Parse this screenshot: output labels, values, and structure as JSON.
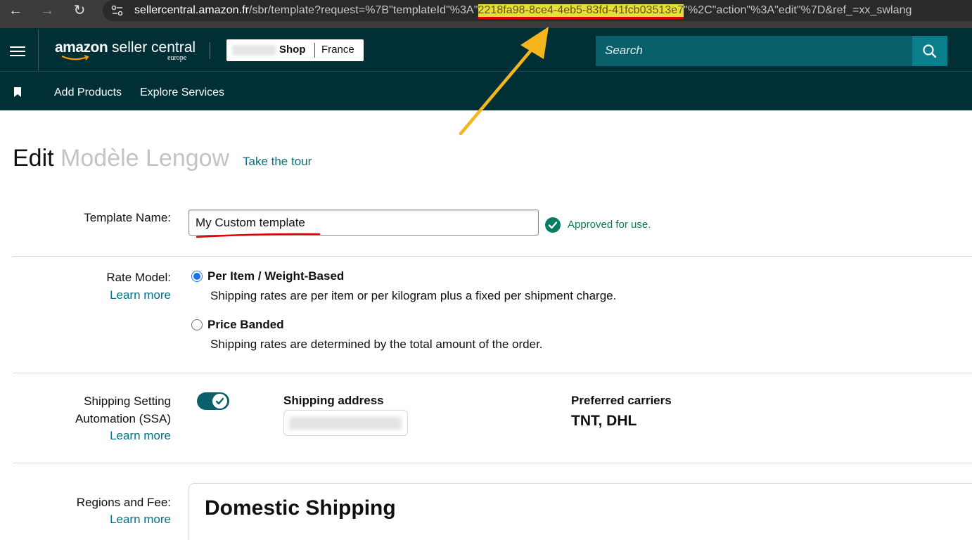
{
  "browser": {
    "url_host": "sellercentral.amazon.fr",
    "url_before": "/sbr/template?request=%7B\"templateId\"%3A\"",
    "url_highlight": "2218fa98-8ce4-4eb5-83fd-41fcb03513e7",
    "url_after": "\"%2C\"action\"%3A\"edit\"%7D&ref_=xx_swlang"
  },
  "header": {
    "logo_brand": "amazon",
    "logo_product": "seller central",
    "logo_region": "europe",
    "store_shop": "Shop",
    "store_country": "France",
    "search_placeholder": "Search",
    "nav": {
      "add_products": "Add Products",
      "explore_services": "Explore Services"
    }
  },
  "page": {
    "title_prefix": "Edit",
    "title_name": "Modèle Lengow",
    "tour_link": "Take the tour",
    "template_name": {
      "label": "Template Name:",
      "value": "My Custom template",
      "status": "Approved for use."
    },
    "rate_model": {
      "label": "Rate Model:",
      "learn_more": "Learn more",
      "options": [
        {
          "title": "Per Item / Weight-Based",
          "desc": "Shipping rates are per item or per kilogram plus a fixed per shipment charge.",
          "selected": true
        },
        {
          "title": "Price Banded",
          "desc": "Shipping rates are determined by the total amount of the order.",
          "selected": false
        }
      ]
    },
    "ssa": {
      "label_line1": "Shipping Setting",
      "label_line2": "Automation (SSA)",
      "learn_more": "Learn more",
      "enabled": true,
      "address_heading": "Shipping address",
      "carriers_heading": "Preferred carriers",
      "carriers_value": "TNT, DHL"
    },
    "regions": {
      "label": "Regions and Fee:",
      "learn_more": "Learn more",
      "panel_title": "Domestic Shipping"
    }
  },
  "colors": {
    "header_bg": "#002f36",
    "search_bg": "#09606b",
    "search_btn": "#0a7f8c",
    "link": "#007185",
    "success": "#067d62",
    "radio_selected": "#1a73e8",
    "annotation_arrow": "#f5b51c",
    "annotation_underline": "#e00000"
  }
}
